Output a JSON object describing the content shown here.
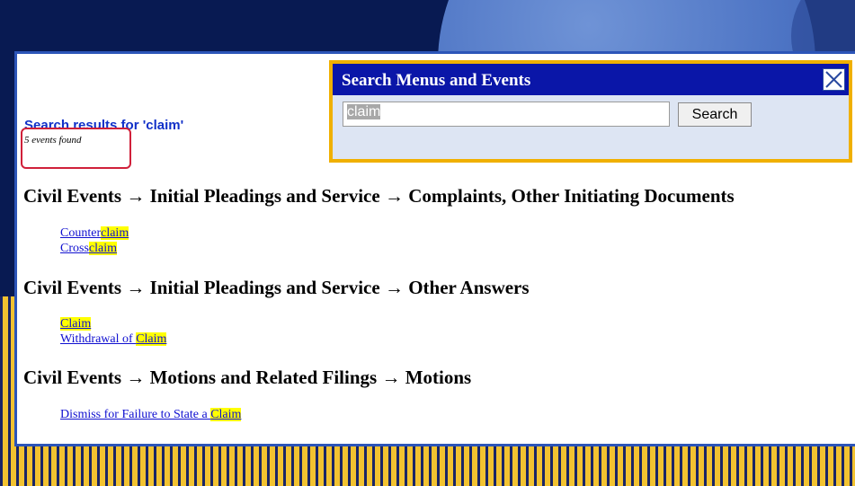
{
  "search_dialog": {
    "title": "Search Menus and Events",
    "input_value": "claim",
    "search_button_label": "Search"
  },
  "results": {
    "title": "Search results for 'claim'",
    "count_text": "5 events found"
  },
  "categories": [
    {
      "heading": "Civil Events → Initial Pleadings and Service → Complaints, Other Initiating Documents",
      "events": [
        {
          "prefix": "Counter",
          "match": "claim",
          "suffix": ""
        },
        {
          "prefix": "Cross",
          "match": "claim",
          "suffix": ""
        }
      ]
    },
    {
      "heading": "Civil Events → Initial Pleadings and Service → Other Answers",
      "events": [
        {
          "prefix": "",
          "match": "Claim",
          "suffix": ""
        },
        {
          "prefix": "Withdrawal of ",
          "match": "Claim",
          "suffix": ""
        }
      ]
    },
    {
      "heading": "Civil Events → Motions and Related Filings → Motions",
      "events": [
        {
          "prefix": "Dismiss for Failure to State a ",
          "match": "Claim",
          "suffix": ""
        }
      ]
    }
  ],
  "colors": {
    "dialog_header": "#0a16a8",
    "dialog_border": "#f0b000",
    "link": "#1010d0",
    "highlight": "#ffff00",
    "count_outline": "#d0203a"
  }
}
